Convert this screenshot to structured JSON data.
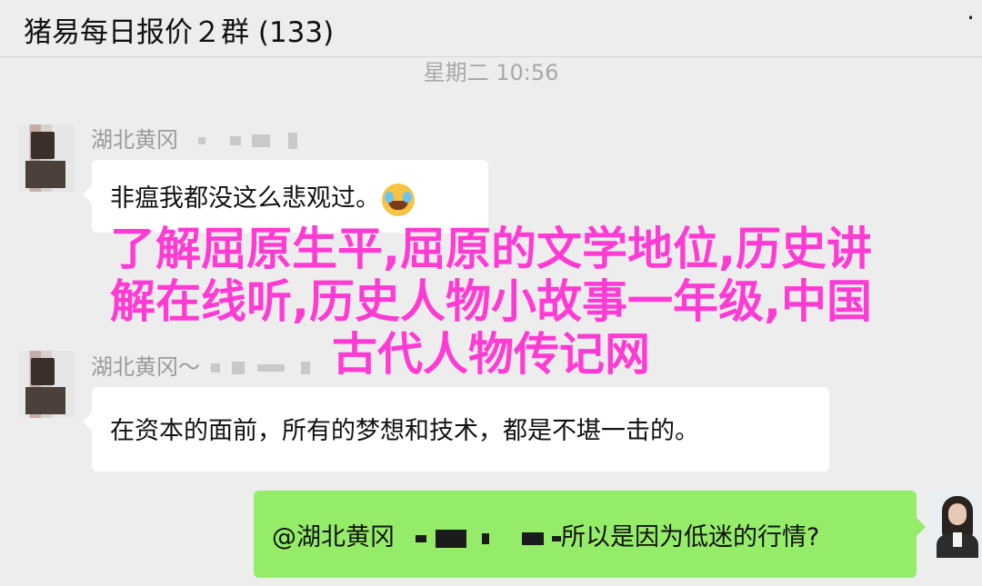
{
  "header": {
    "title": "猪易每日报价２群 (133)",
    "more_glyph": "·"
  },
  "timestamp_text": "星期二 10:56",
  "messages": [
    {
      "sender": "湖北黄冈",
      "text": "非瘟我都没这么悲观过。",
      "emoji": "loudly-crying-face-icon"
    },
    {
      "sender": "湖北黄冈～",
      "text": "在资本的面前，所有的梦想和技术，都是不堪一击的。"
    },
    {
      "mention": "@湖北黄冈",
      "text": "所以是因为低迷的行情?"
    }
  ],
  "overlay": {
    "lines": [
      "了解屈原生平,屈原的文学地位,历史讲",
      "解在线听,历史人物小故事一年级,中国",
      "古代人物传记网"
    ],
    "color": "#ff3bd4"
  },
  "colors": {
    "background": "#ededed",
    "self_bubble": "#95ec69"
  }
}
